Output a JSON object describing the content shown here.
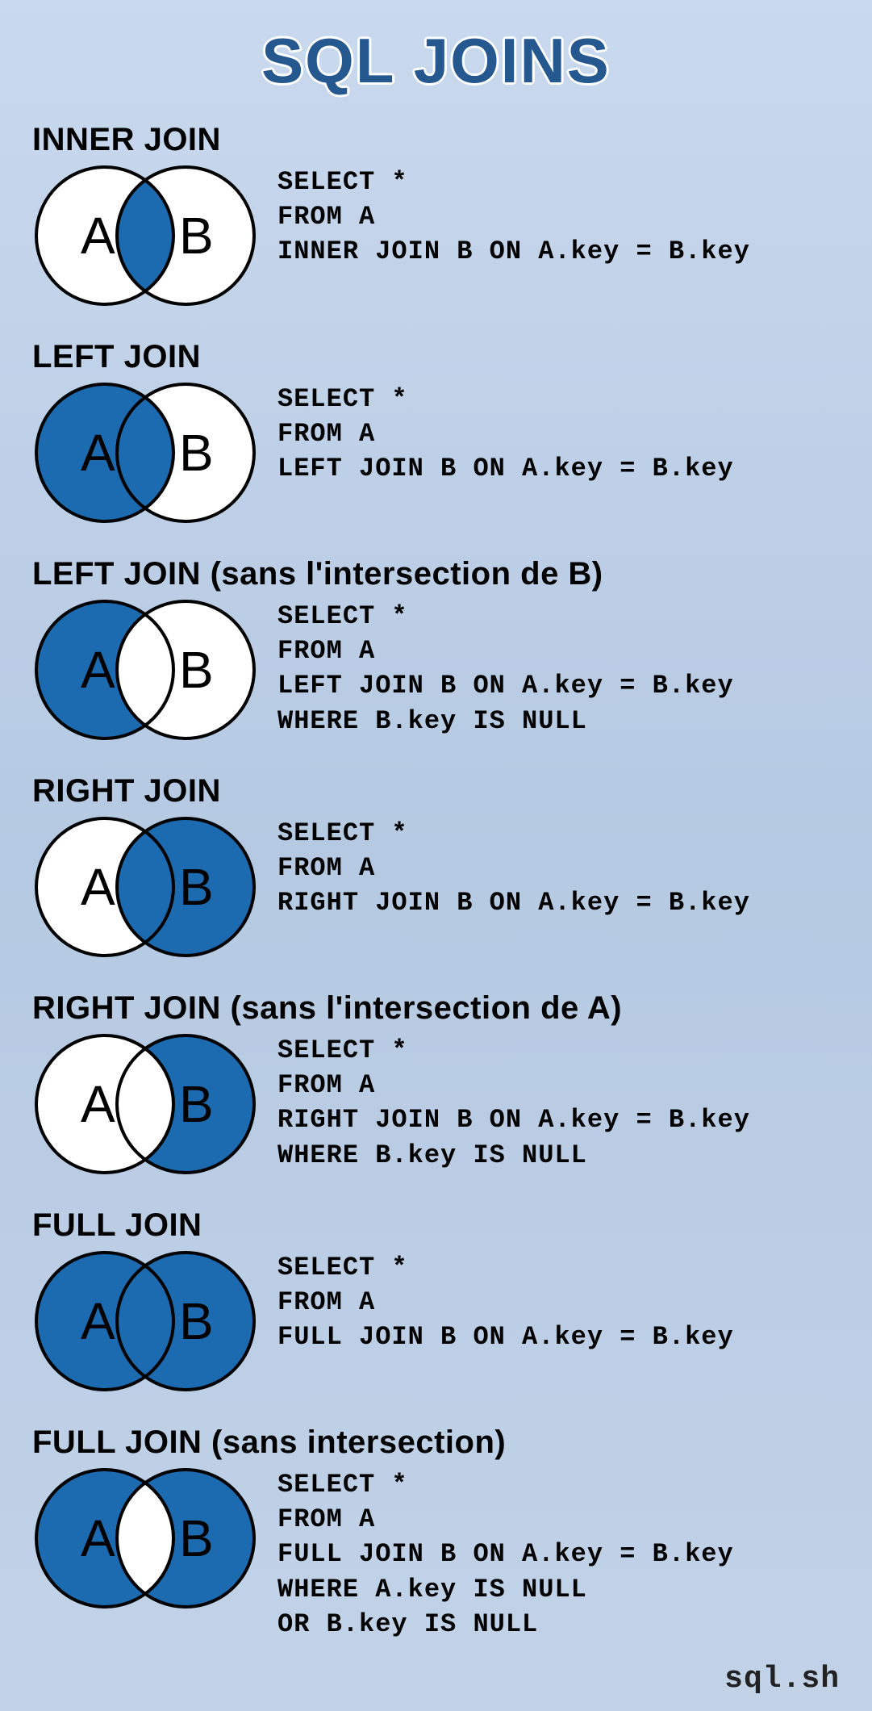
{
  "title": "SQL JOINS",
  "footer": "sql.sh",
  "labels": {
    "A": "A",
    "B": "B"
  },
  "colors": {
    "fill": "#1c6bb0",
    "stroke": "#000000",
    "empty": "#ffffff"
  },
  "joins": [
    {
      "id": "inner",
      "title": "INNER JOIN",
      "code": "SELECT *\nFROM A\nINNER JOIN B ON A.key = B.key",
      "venn": {
        "a": "empty",
        "b": "empty",
        "intersection": "fill"
      }
    },
    {
      "id": "left",
      "title": "LEFT JOIN",
      "code": "SELECT *\nFROM A\nLEFT JOIN B ON A.key = B.key",
      "venn": {
        "a": "fill",
        "b": "empty",
        "intersection": "fill"
      }
    },
    {
      "id": "left-null",
      "title": "LEFT JOIN (sans l'intersection de B)",
      "code": "SELECT *\nFROM A\nLEFT JOIN B ON A.key = B.key\nWHERE B.key IS NULL",
      "venn": {
        "a": "fill",
        "b": "empty",
        "intersection": "empty"
      }
    },
    {
      "id": "right",
      "title": "RIGHT JOIN",
      "code": "SELECT *\nFROM A\nRIGHT JOIN B ON A.key = B.key",
      "venn": {
        "a": "empty",
        "b": "fill",
        "intersection": "fill"
      }
    },
    {
      "id": "right-null",
      "title": "RIGHT JOIN (sans l'intersection de A)",
      "code": "SELECT *\nFROM A\nRIGHT JOIN B ON A.key = B.key\nWHERE B.key IS NULL",
      "venn": {
        "a": "empty",
        "b": "fill",
        "intersection": "empty"
      }
    },
    {
      "id": "full",
      "title": "FULL JOIN",
      "code": "SELECT *\nFROM A\nFULL JOIN B ON A.key = B.key",
      "venn": {
        "a": "fill",
        "b": "fill",
        "intersection": "fill"
      }
    },
    {
      "id": "full-null",
      "title": "FULL JOIN (sans intersection)",
      "code": "SELECT *\nFROM A\nFULL JOIN B ON A.key = B.key\nWHERE A.key IS NULL\nOR B.key IS NULL",
      "venn": {
        "a": "fill",
        "b": "fill",
        "intersection": "empty"
      }
    }
  ]
}
